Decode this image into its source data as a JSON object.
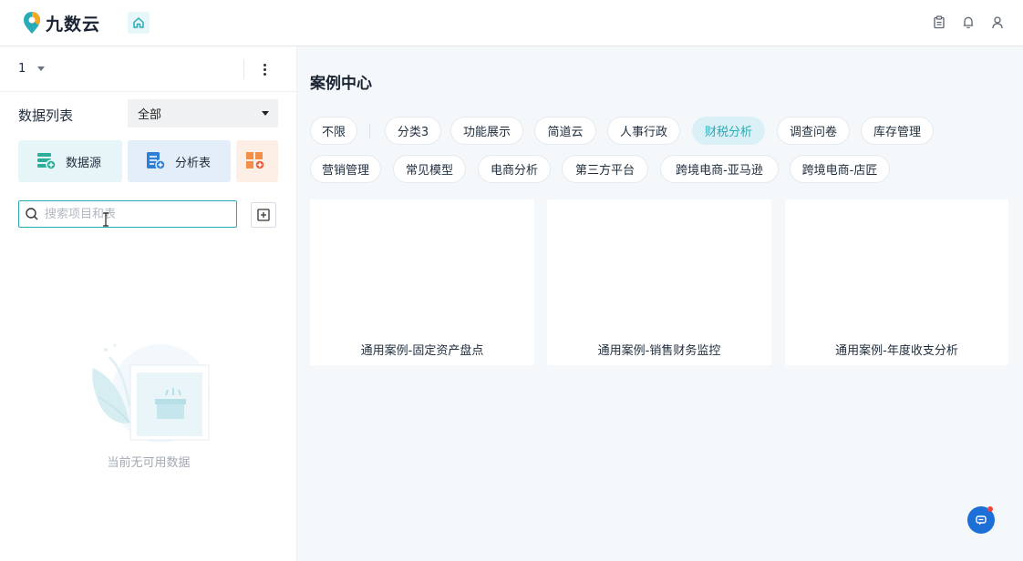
{
  "app": {
    "logo_text": "九数云",
    "brand_color": "#29aab7"
  },
  "topbar": {
    "icons": [
      "home-icon",
      "clipboard-icon",
      "bell-icon",
      "user-icon"
    ]
  },
  "sidebar": {
    "project_name": "1",
    "list_title": "数据列表",
    "filter_value": "全部",
    "create_buttons": [
      {
        "label": "数据源",
        "icon": "datasource-add-icon"
      },
      {
        "label": "分析表",
        "icon": "analysis-table-add-icon"
      },
      {
        "label": "",
        "icon": "dashboard-add-icon"
      }
    ],
    "search_placeholder": "搜索项目和表",
    "empty_text": "当前无可用数据"
  },
  "main": {
    "title": "案例中心",
    "tags_row1": [
      "不限",
      "分类3",
      "功能展示",
      "简道云",
      "人事行政",
      "财税分析",
      "调查问卷",
      "库存管理"
    ],
    "tags_row2": [
      "营销管理",
      "常见模型",
      "电商分析",
      "第三方平台",
      "跨境电商-亚马逊",
      "跨境电商-店匠"
    ],
    "active_tag": "财税分析",
    "cards": [
      {
        "label": "通用案例-固定资产盘点"
      },
      {
        "label": "通用案例-销售财务监控"
      },
      {
        "label": "通用案例-年度收支分析"
      }
    ]
  }
}
